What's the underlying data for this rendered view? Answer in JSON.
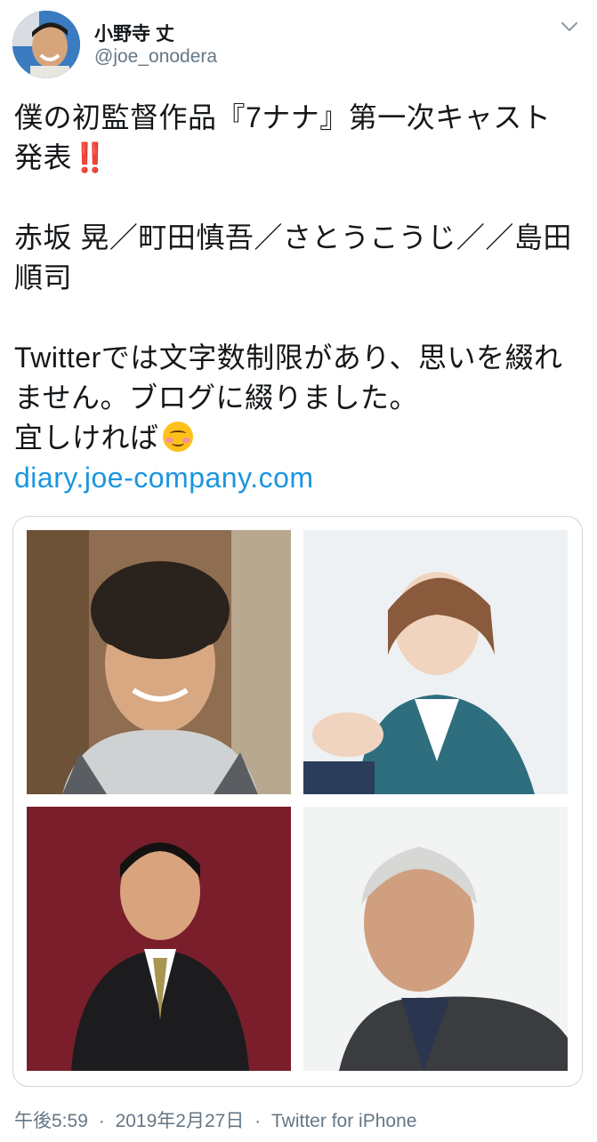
{
  "author": {
    "display_name": "小野寺 丈",
    "handle": "@joe_onodera"
  },
  "tweet": {
    "line1": "僕の初監督作品『7ナナ』第一次キャスト",
    "line2": "発表",
    "line2_emoji": "‼️",
    "line3": "赤坂 晃／町田慎吾／さとうこうじ／／島田",
    "line4": "順司",
    "line5": "Twitterでは文字数制限があり、思いを綴れ",
    "line6": "ません。ブログに綴りました。",
    "line7": "宜しければ",
    "line7_emoji": "☺️",
    "link": "diary.joe-company.com"
  },
  "footer": {
    "time": "午後5:59",
    "separator": "·",
    "date": "2019年2月27日",
    "source": "Twitter for iPhone"
  },
  "icons": {
    "menu": "chevron-down-icon",
    "avatar": "avatar-photo",
    "emoji_bang": "double-exclamation-emoji",
    "emoji_smile": "smiling-blush-emoji"
  },
  "colors": {
    "link": "#1b95e0",
    "meta": "#657786",
    "text": "#14171a"
  }
}
